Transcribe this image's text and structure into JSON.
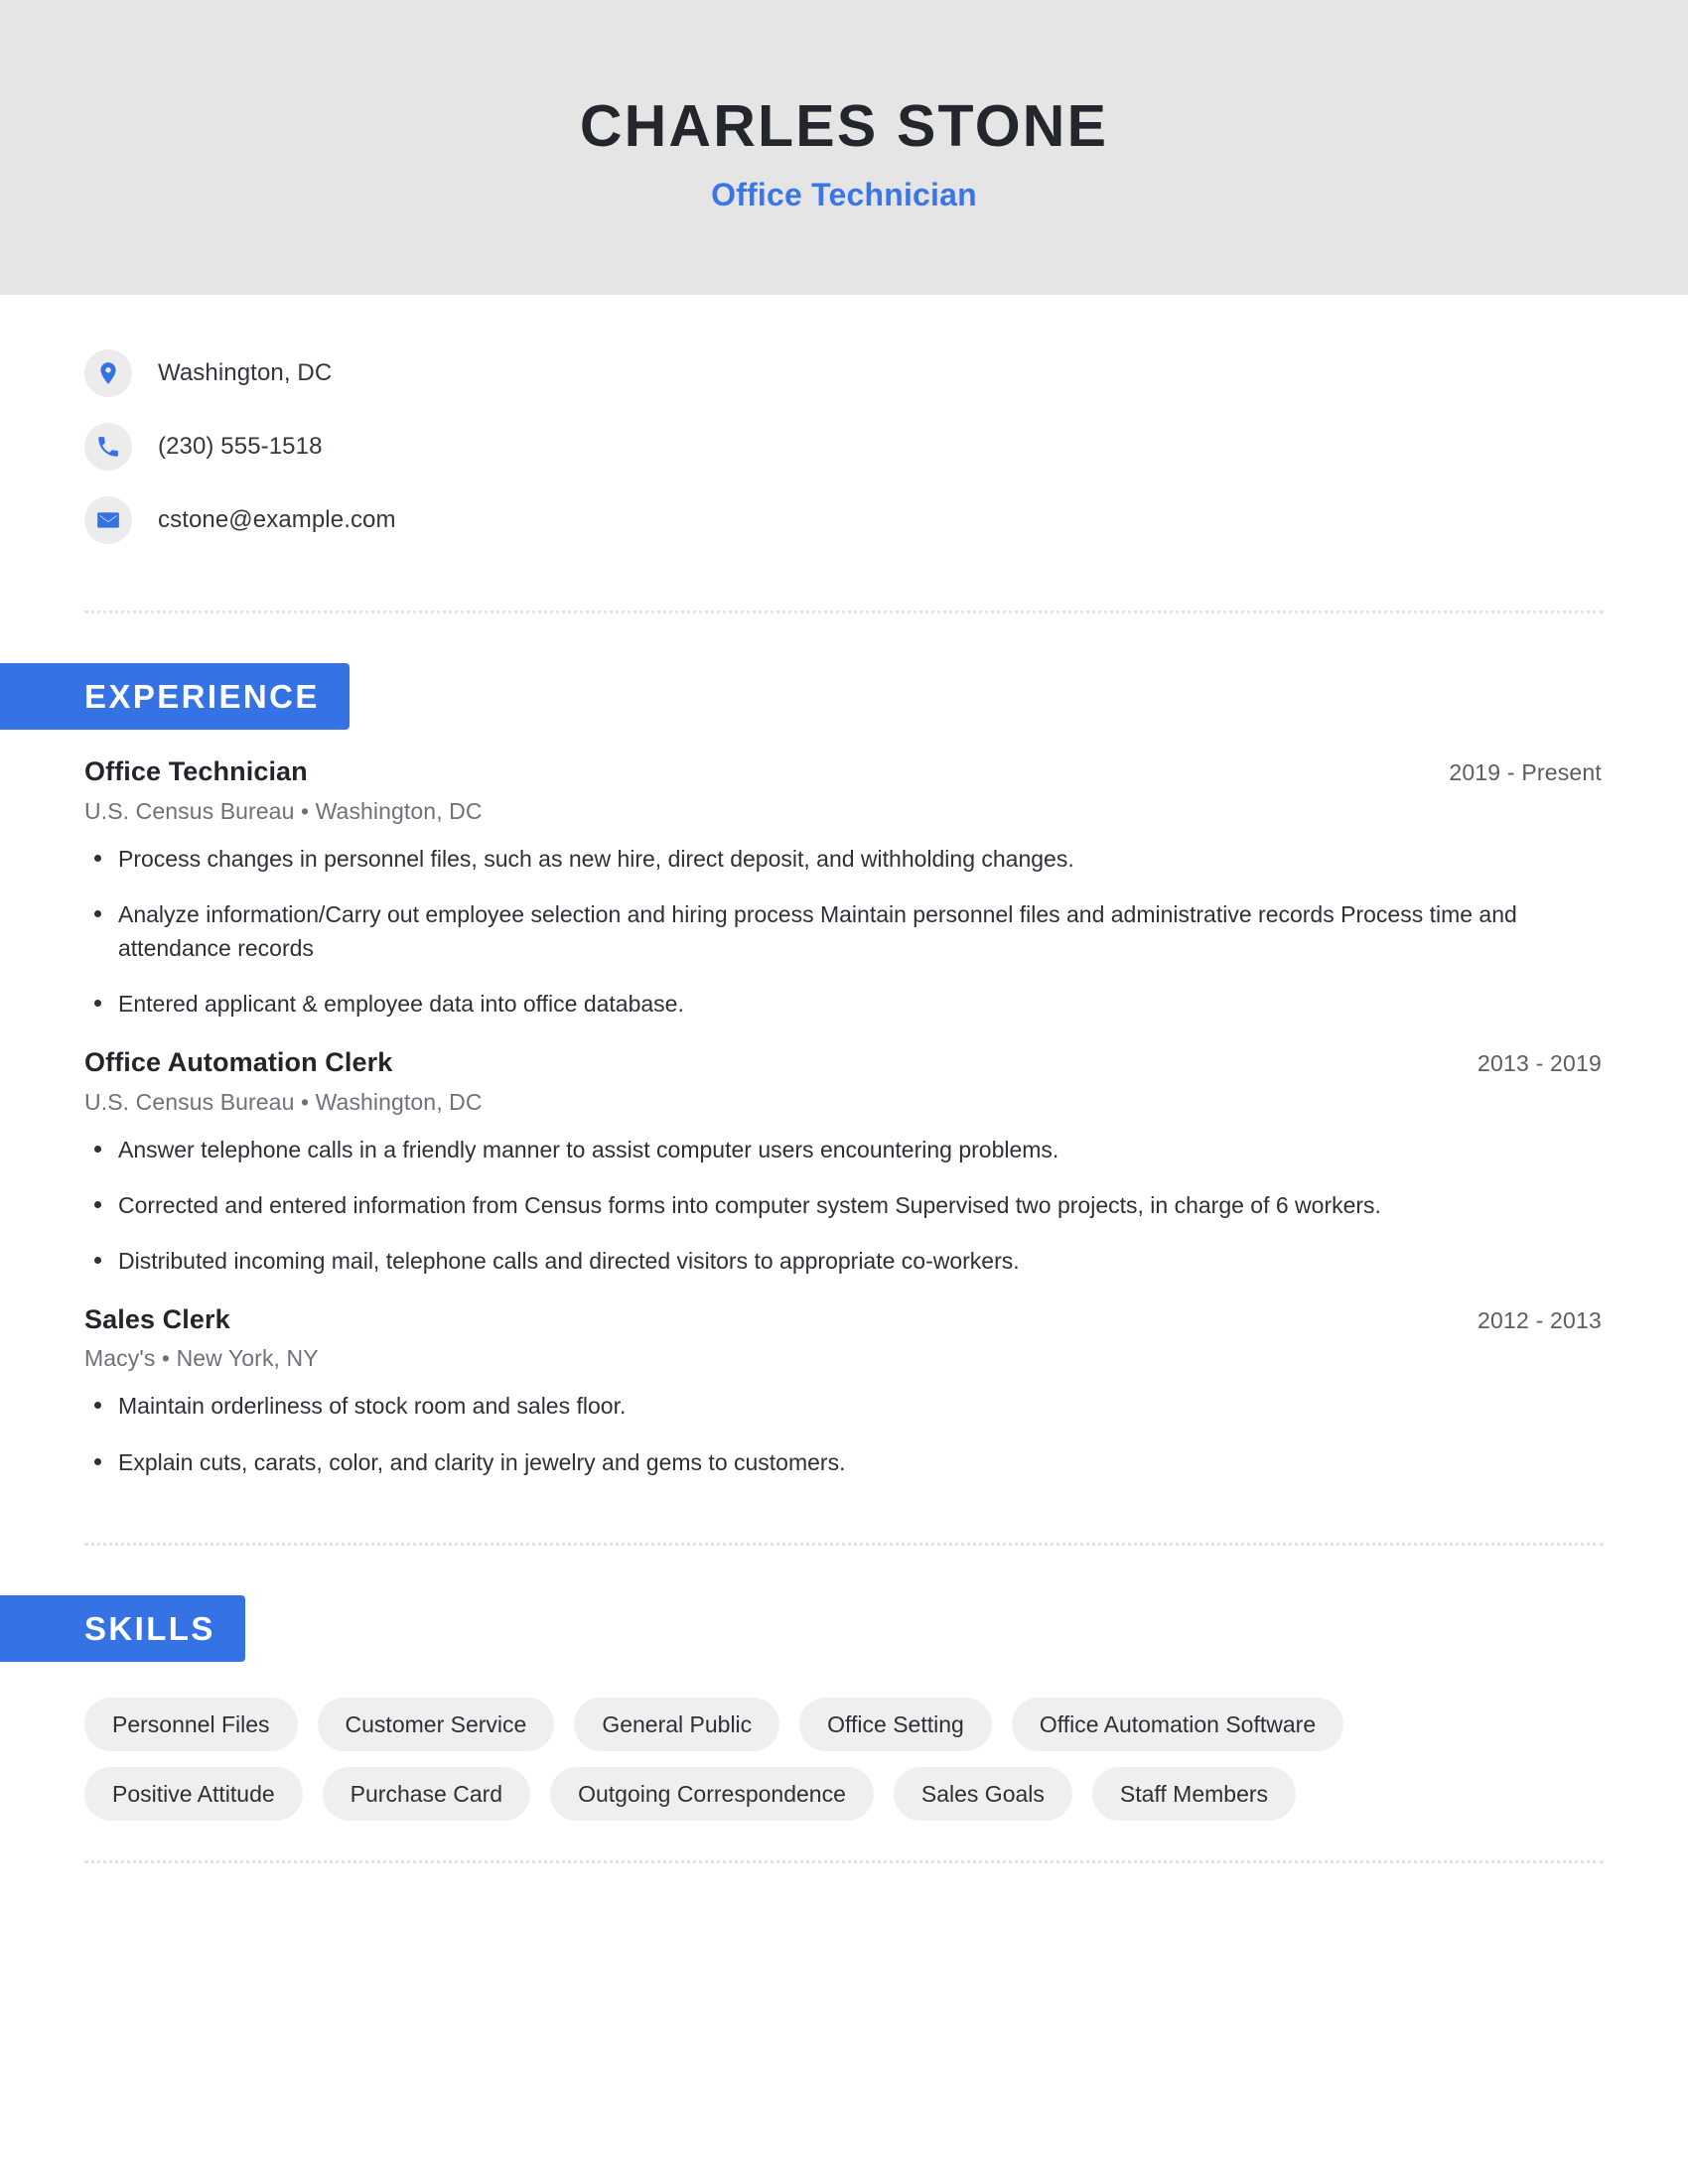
{
  "theme": {
    "accent": "#3572E3",
    "header_background": "#E5E5E5",
    "title_color": "#23262B",
    "pill_background": "#EFEFEF"
  },
  "header": {
    "name": "CHARLES STONE",
    "title": "Office Technician"
  },
  "contact": {
    "items": [
      {
        "icon": "location-pin-icon",
        "value": "Washington, DC"
      },
      {
        "icon": "phone-icon",
        "value": "(230) 555-1518"
      },
      {
        "icon": "email-icon",
        "value": "cstone@example.com"
      }
    ]
  },
  "experience": {
    "heading": "EXPERIENCE",
    "jobs": [
      {
        "role": "Office Technician",
        "dates": "2019 - Present",
        "employer": "U.S. Census Bureau",
        "location": "Washington, DC",
        "meta": "U.S. Census Bureau  •  Washington, DC",
        "bullets": [
          "Process changes in personnel files, such as new hire, direct deposit, and withholding changes.",
          "Analyze information/Carry out employee selection and hiring process Maintain personnel files and administrative records Process time and attendance records",
          "Entered applicant & employee data into office database."
        ]
      },
      {
        "role": "Office Automation Clerk",
        "dates": "2013 - 2019",
        "employer": "U.S. Census Bureau",
        "location": "Washington, DC",
        "meta": "U.S. Census Bureau  •  Washington, DC",
        "bullets": [
          "Answer telephone calls in a friendly manner to assist computer users encountering problems.",
          "Corrected and entered information from Census forms into computer system Supervised two projects, in charge of 6 workers.",
          "Distributed incoming mail, telephone calls and directed visitors to appropriate co-workers."
        ]
      },
      {
        "role": "Sales Clerk",
        "dates": "2012 - 2013",
        "employer": "Macy's",
        "location": "New York, NY",
        "meta": "Macy's  •  New York, NY",
        "bullets": [
          "Maintain orderliness of stock room and sales floor.",
          "Explain cuts, carats, color, and clarity in jewelry and gems to customers."
        ]
      }
    ]
  },
  "skills": {
    "heading": "SKILLS",
    "items": [
      "Personnel Files",
      "Customer Service",
      "General Public",
      "Office Setting",
      "Office Automation Software",
      "Positive Attitude",
      "Purchase Card",
      "Outgoing Correspondence",
      "Sales Goals",
      "Staff Members"
    ]
  }
}
